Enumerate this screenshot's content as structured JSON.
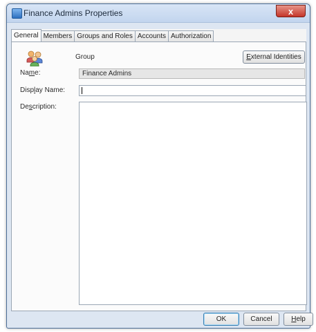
{
  "window": {
    "title": "Finance Admins Properties",
    "close_glyph": "x"
  },
  "tabs": [
    {
      "label": "General",
      "active": true
    },
    {
      "label": "Members",
      "active": false
    },
    {
      "label": "Groups and Roles",
      "active": false
    },
    {
      "label": "Accounts",
      "active": false
    },
    {
      "label": "Authorization",
      "active": false
    }
  ],
  "general": {
    "type_label": "Group",
    "external_button": {
      "mnemonic": "E",
      "rest": "xternal Identities"
    },
    "name_label": {
      "pre": "Na",
      "mnemonic": "m",
      "post": "e:"
    },
    "name_value": "Finance Admins",
    "display_label": {
      "pre": "Disp",
      "mnemonic": "l",
      "post": "ay Name:"
    },
    "display_value": "",
    "description_label": {
      "pre": "De",
      "mnemonic": "s",
      "post": "cription:"
    },
    "description_value": ""
  },
  "buttons": {
    "ok": "OK",
    "cancel": "Cancel",
    "help": {
      "mnemonic": "H",
      "rest": "elp"
    }
  },
  "icons": {
    "title_icon": "window-app-icon",
    "group_icon": "group-users-icon"
  }
}
